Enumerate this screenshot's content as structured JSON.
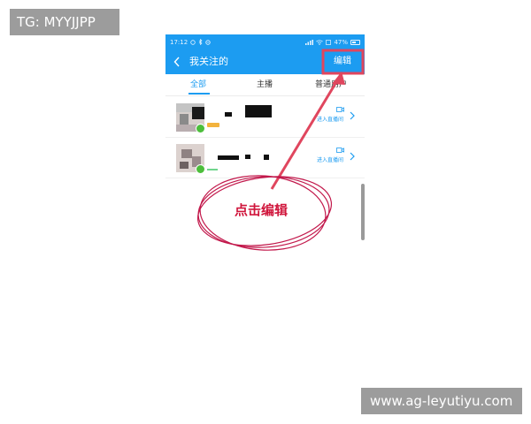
{
  "watermarks": {
    "top": "TG: MYYJJPP",
    "bottom": "www.ag-leyutiyu.com"
  },
  "status_bar": {
    "time": "17:12",
    "battery": "47%"
  },
  "app_bar": {
    "title": "我关注的",
    "edit_label": "编辑"
  },
  "tabs": [
    {
      "label": "全部",
      "selected": true
    },
    {
      "label": "主播",
      "selected": false
    },
    {
      "label": "普通用户",
      "selected": false
    }
  ],
  "follow_list": [
    {
      "live_text": "进入直播间"
    },
    {
      "live_text": "进入直播间"
    }
  ],
  "annotation": {
    "callout": "点击编辑",
    "color": "#d0163c"
  },
  "colors": {
    "accent": "#1c9cf1",
    "badge_green": "#4cbe3b",
    "badge_gold": "#f3b33d"
  }
}
